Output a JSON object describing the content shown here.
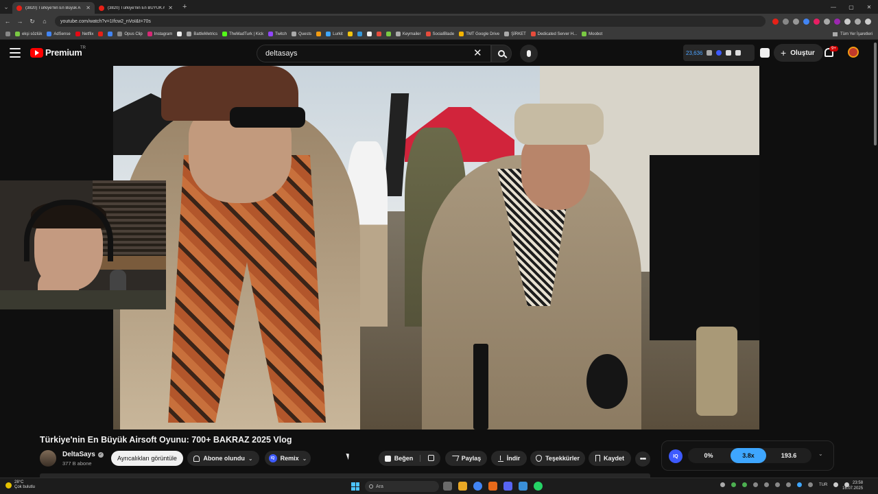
{
  "browser": {
    "tabs": [
      {
        "title": "(3820) Türkiye'nin En Büyük A",
        "active": true
      },
      {
        "title": "(3820) Türkiye'nin En BÜYÜK A",
        "active": false
      }
    ],
    "url": "youtube.com/watch?v=1Ifcw2_nVoI&t=70s",
    "bookmarks": [
      {
        "label": "ekşi sözlük",
        "color": "#7ac943"
      },
      {
        "label": "AdSense",
        "color": "#4285f4"
      },
      {
        "label": "Netflix",
        "color": "#e50914"
      },
      {
        "label": "Opus Clip",
        "color": "#888888"
      },
      {
        "label": "Instagram",
        "color": "#d62976"
      },
      {
        "label": "BattleMetrics",
        "color": "#aaaaaa"
      },
      {
        "label": "TheMadTurk | Kick",
        "color": "#53fc18"
      },
      {
        "label": "Twitch",
        "color": "#9146ff"
      },
      {
        "label": "Quests",
        "color": "#aaaaaa"
      },
      {
        "label": "Lurkit",
        "color": "#3ea6ff"
      },
      {
        "label": "Keymailer",
        "color": "#aaaaaa"
      },
      {
        "label": "SocialBlade",
        "color": "#e74c3c"
      },
      {
        "label": "TMT Google Drive",
        "color": "#f4b400"
      },
      {
        "label": "ŞİRKET",
        "color": "#aaaaaa"
      },
      {
        "label": "Dedicated Server H...",
        "color": "#e74c3c"
      },
      {
        "label": "Moobot",
        "color": "#7ac943"
      }
    ],
    "bookmarks_all": "Tüm Yer İşaretleri"
  },
  "youtube": {
    "logo_text": "Premium",
    "logo_country": "TR",
    "search_value": "deltasays",
    "header_count": "23,636",
    "create_label": "Oluştur",
    "notif_badge": "9+"
  },
  "video": {
    "title": "Türkiye'nin En Büyük Airsoft Oyunu: 700+ BAKRAZ 2025 Vlog",
    "channel": "DeltaSays",
    "subscribers": "377 B abone",
    "memberships_label": "Ayrıcalıkları görüntüle",
    "subscribed_label": "Abone olundu",
    "remix_label": "Remix",
    "like_label": "Beğen",
    "share_label": "Paylaş",
    "download_label": "İndir",
    "thanks_label": "Teşekkürler",
    "save_label": "Kaydet"
  },
  "extension": {
    "logo": "IQ",
    "segments": [
      {
        "label": "0%",
        "active": false
      },
      {
        "label": "3.8x",
        "active": true
      },
      {
        "label": "193.6",
        "active": false
      }
    ]
  },
  "taskbar": {
    "weather_temp": "28°C",
    "weather_desc": "Çok bulutlu",
    "search_placeholder": "Ara",
    "lang": "TUR",
    "time": "23:58",
    "date": "16.07.2025"
  },
  "colors": {
    "yt_red": "#ff0000",
    "accent_blue": "#3ea6ff",
    "background": "#0f0f0f"
  }
}
